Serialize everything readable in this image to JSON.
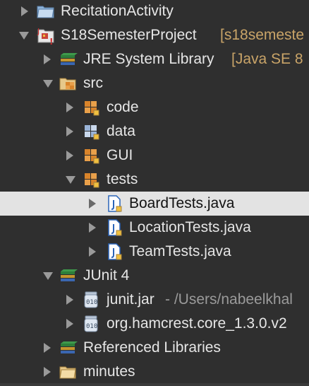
{
  "tree": {
    "recitation_activity": "RecitationActivity",
    "project_name": "S18SemesterProject",
    "project_detail": "[s18semeste",
    "jre_label": "JRE System Library",
    "jre_detail": "[Java SE 8",
    "src_label": "src",
    "pkg_code": "code",
    "pkg_data": "data",
    "pkg_gui": "GUI",
    "pkg_tests": "tests",
    "file_board": "BoardTests.java",
    "file_location": "LocationTests.java",
    "file_team": "TeamTests.java",
    "junit_label": "JUnit 4",
    "junit_jar": "junit.jar",
    "junit_jar_detail": "- /Users/nabeelkhal",
    "hamcrest_jar": "org.hamcrest.core_1.3.0.v2",
    "ref_libs": "Referenced Libraries",
    "minutes": "minutes"
  },
  "colors": {
    "background": "#2f2f2f",
    "selection": "#e3e3e3",
    "text": "#e6e6e6",
    "decoration": "#c9a468",
    "package_orange": "#d9842a",
    "java_file_blue": "#2a64b8",
    "library_stack": [
      "#2e7f3a",
      "#c5962e",
      "#3a66b0"
    ]
  },
  "icons": {
    "recitation_activity": "folder-icon",
    "project": "java-project-icon",
    "jre": "library-icon",
    "src": "source-folder-icon",
    "packages": "package-icon",
    "java_files": "java-file-icon",
    "jars": "jar-icon",
    "minutes": "folder-icon"
  }
}
